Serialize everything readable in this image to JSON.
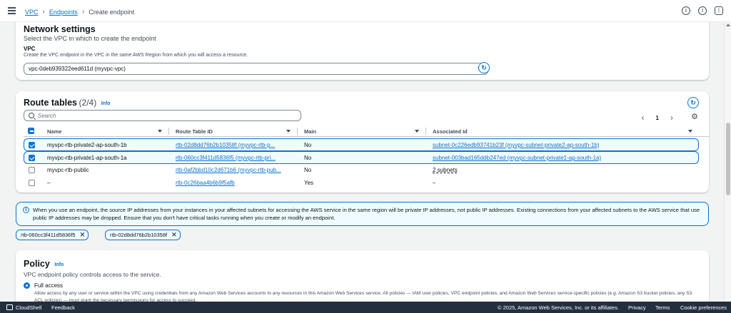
{
  "header": {
    "breadcrumbs": [
      "VPC",
      "Endpoints"
    ],
    "current_page": "Create endpoint",
    "icons": [
      "info-icon",
      "notifications-icon",
      "settings-icon"
    ]
  },
  "network": {
    "title": "Network settings",
    "description": "Select the VPC in which to create the endpoint",
    "vpc_label": "VPC",
    "vpc_help": "Create the VPC endpoint in the VPC in the same AWS Region from which you will access a resource.",
    "vpc_value": "vpc-0deb939322eed611d (myvpc-vpc)"
  },
  "route_tables": {
    "title": "Route tables",
    "count": "(2/4)",
    "info": "Info",
    "search_placeholder": "Search",
    "page": "1",
    "columns": [
      "Name",
      "Route Table ID",
      "Main",
      "Associated Id"
    ],
    "rows": [
      {
        "name": "myvpc-rtb-private2-ap-south-1b",
        "id": "rtb-02d8dd76b2b10358f (myvpc-rtb-p...",
        "main": "No",
        "assoc": "subnet-0c226edb93741b23f (myvpc-subnet-private2-ap-south-1b)",
        "selected": true
      },
      {
        "name": "myvpc-rtb-private1-ap-south-1a",
        "id": "rtb-060cc3f411d5836f5 (myvpc-rtb-pri...",
        "main": "No",
        "assoc": "subnet-003bad165ddb247ed (myvpc-subnet-private1-ap-south-1a)",
        "selected": true
      },
      {
        "name": "myvpc-rtb-public",
        "id": "rtb-0af2bbd10c2d671b6 (myvpc-rtb-pub...",
        "main": "No",
        "assoc": "2 subnets",
        "selected": false
      },
      {
        "name": "–",
        "id": "rtb-0c26baa4b6b9f5afb",
        "main": "Yes",
        "assoc": "–",
        "selected": false
      }
    ]
  },
  "alert": {
    "text": "When you use an endpoint, the source IP addresses from your instances in your affected subnets for accessing the AWS service in the same region will be private IP addresses, not public IP addresses. Existing connections from your affected subnets to the AWS service that use public IP addresses may be dropped. Ensure that you don't have critical tasks running when you create or modify an endpoint."
  },
  "tokens": [
    "rtb-060cc3f411d5836f5",
    "rtb-02d8dd76b2b10358f"
  ],
  "policy": {
    "title": "Policy",
    "info": "Info",
    "description": "VPC endpoint policy controls access to the service.",
    "option_label": "Full access",
    "option_desc": "Allow access by any user or service within the VPC using credentials from any Amazon Web Services accounts to any resources in this Amazon Web Services service. All policies — IAM user policies, VPC endpoint policies, and Amazon Web Services service-specific policies (e.g. Amazon S3 bucket policies, any S3 ACL policies) — must grant the necessary permissions for access to succeed."
  },
  "footer": {
    "cloudshell": "CloudShell",
    "feedback": "Feedback",
    "copyright": "© 2025, Amazon Web Services, Inc. or its affiliates.",
    "privacy": "Privacy",
    "terms": "Terms",
    "cookies": "Cookie preferences"
  },
  "colors": {
    "accent": "#0972d3",
    "footer_bg": "#232f3e",
    "selected_row_bg": "#f0fbff"
  }
}
